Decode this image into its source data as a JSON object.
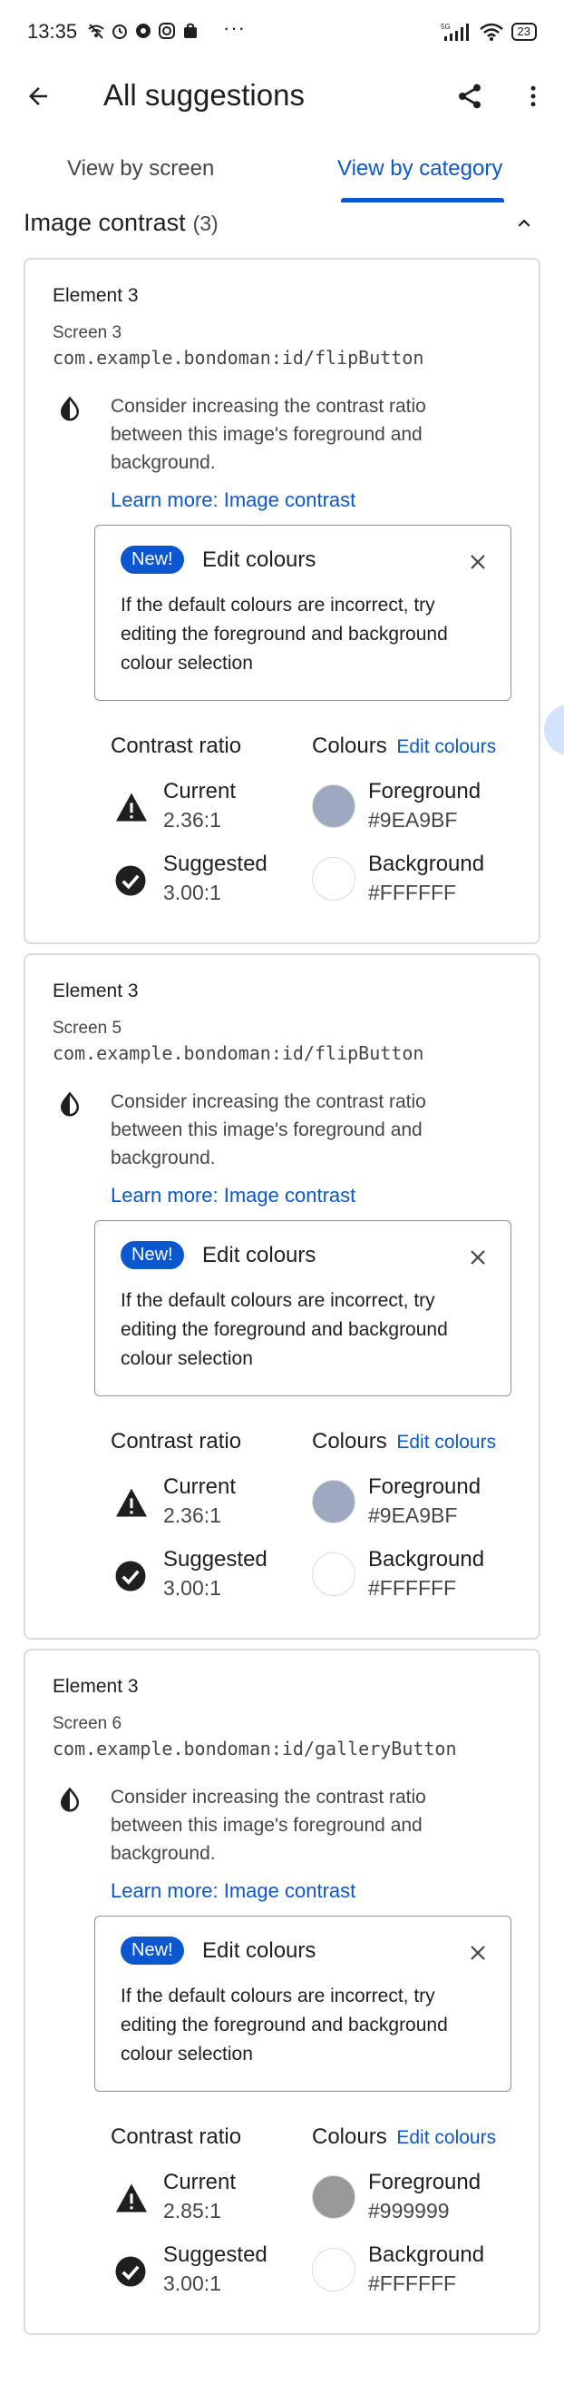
{
  "status_bar": {
    "time": "13:35",
    "left_icons": [
      "wifi-off-icon",
      "alarm-icon",
      "app-icon",
      "instagram-icon",
      "shopping-icon"
    ],
    "more": "···",
    "network": "5G",
    "battery": "23"
  },
  "app_bar": {
    "title": "All suggestions"
  },
  "tabs": [
    {
      "label": "View by screen",
      "selected": false
    },
    {
      "label": "View by category",
      "selected": true
    }
  ],
  "section": {
    "title": "Image contrast",
    "count": "(3)"
  },
  "common": {
    "learn_more": "Learn more: Image contrast",
    "new_badge": "New!",
    "edit_title": "Edit colours",
    "edit_body": "If the default colours are incorrect, try editing the foreground and background colour selection",
    "description": "Consider increasing the contrast ratio between this image's foreground and background.",
    "contrast_ratio_label": "Contrast ratio",
    "colours_label": "Colours",
    "edit_colours_link": "Edit colours",
    "current_label": "Current",
    "suggested_label": "Suggested",
    "foreground_label": "Foreground",
    "background_label": "Background"
  },
  "cards": [
    {
      "element": "Element 3",
      "screen": "Screen 3",
      "id": "com.example.bondoman:id/flipButton",
      "current_ratio": "2.36:1",
      "suggested_ratio": "3.00:1",
      "foreground_hex": "#9EA9BF",
      "background_hex": "#FFFFFF"
    },
    {
      "element": "Element 3",
      "screen": "Screen 5",
      "id": "com.example.bondoman:id/flipButton",
      "current_ratio": "2.36:1",
      "suggested_ratio": "3.00:1",
      "foreground_hex": "#9EA9BF",
      "background_hex": "#FFFFFF"
    },
    {
      "element": "Element 3",
      "screen": "Screen 6",
      "id": "com.example.bondoman:id/galleryButton",
      "current_ratio": "2.85:1",
      "suggested_ratio": "3.00:1",
      "foreground_hex": "#999999",
      "background_hex": "#FFFFFF"
    }
  ],
  "colors": {
    "accent": "#0b57d0",
    "text_primary": "#1f1f1f",
    "text_secondary": "#444746",
    "border": "#dadce0"
  }
}
